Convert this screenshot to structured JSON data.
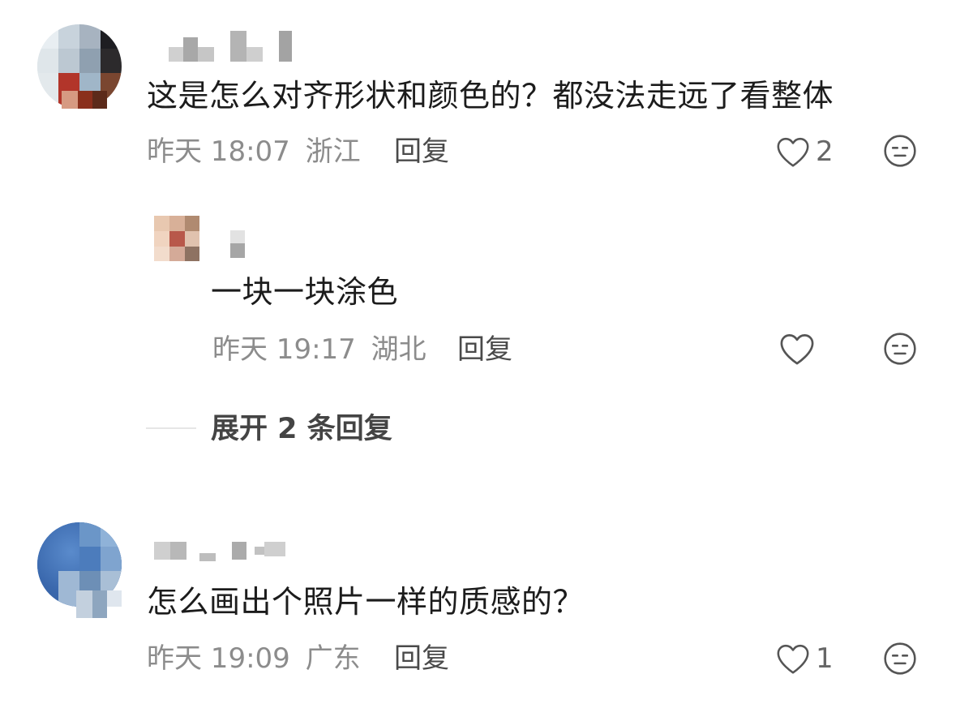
{
  "comments": [
    {
      "text": "这是怎么对齐形状和颜色的？都没法走远了看整体",
      "time": "昨天 18:07",
      "location": "浙江",
      "reply_label": "回复",
      "like_count": "2",
      "replies": [
        {
          "text": "一块一块涂色",
          "time": "昨天 19:17",
          "location": "湖北",
          "reply_label": "回复",
          "like_count": ""
        }
      ],
      "expand_label": "展开 2 条回复"
    },
    {
      "text": "怎么画出个照片一样的质感的？",
      "time": "昨天 19:09",
      "location": "广东",
      "reply_label": "回复",
      "like_count": "1"
    }
  ],
  "icons": {
    "like": "heart-outline-icon",
    "dislike": "neutral-face-icon"
  },
  "colors": {
    "text": "#1c1c1c",
    "meta": "#8c8c8c",
    "icon": "#555555"
  }
}
